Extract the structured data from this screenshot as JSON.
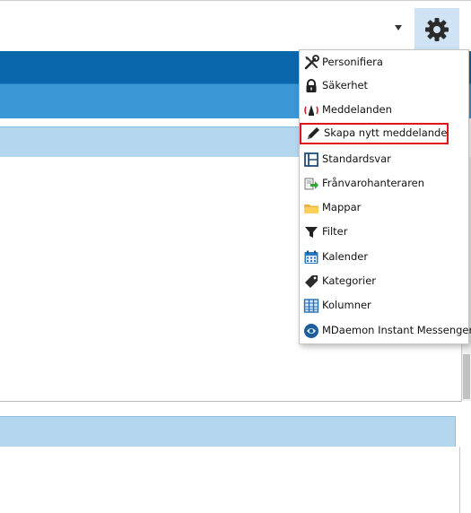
{
  "menu": {
    "items": [
      {
        "label": "Personifiera",
        "icon": "tools-icon"
      },
      {
        "label": "Säkerhet",
        "icon": "lock-icon"
      },
      {
        "label": "Meddelanden",
        "icon": "announcement-icon"
      },
      {
        "label": "Skapa nytt meddelande",
        "icon": "pencil-icon",
        "highlighted": true
      },
      {
        "label": "Standardsvar",
        "icon": "template-icon"
      },
      {
        "label": "Frånvarohanteraren",
        "icon": "out-of-office-icon"
      },
      {
        "label": "Mappar",
        "icon": "folder-icon"
      },
      {
        "label": "Filter",
        "icon": "filter-icon"
      },
      {
        "label": "Kalender",
        "icon": "calendar-icon"
      },
      {
        "label": "Kategorier",
        "icon": "tag-icon"
      },
      {
        "label": "Kolumner",
        "icon": "columns-icon"
      },
      {
        "label": "MDaemon Instant Messenger",
        "icon": "messenger-icon"
      }
    ]
  },
  "colors": {
    "accent_dark": "#0a67ab",
    "accent_mid": "#3c97d6",
    "header_light": "#b5d6ef",
    "highlight_border": "#e0141c",
    "settings_button_bg": "#cfe3f4"
  }
}
